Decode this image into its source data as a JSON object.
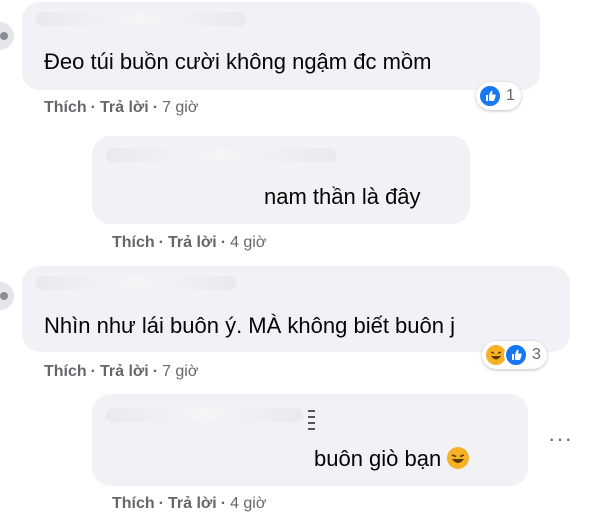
{
  "comments": [
    {
      "text": "Đeo túi buồn cười không ngậm đc mồm",
      "actions": {
        "like": "Thích",
        "reply": "Trả lời",
        "time": "7 giờ"
      },
      "reaction": {
        "icon": "like-icon",
        "count": "1"
      }
    },
    {
      "text": "nam thần là đây",
      "actions": {
        "like": "Thích",
        "reply": "Trả lời",
        "time": "4 giờ"
      }
    },
    {
      "text": "Nhìn như lái buôn ý. MÀ không biết buôn j",
      "actions": {
        "like": "Thích",
        "reply": "Trả lời",
        "time": "7 giờ"
      },
      "reaction": {
        "icons": [
          "haha-icon",
          "like-icon"
        ],
        "count": "3"
      }
    },
    {
      "text": "buôn giò bạn",
      "emoji": "😆",
      "actions": {
        "like": "Thích",
        "reply": "Trả lời",
        "time": "4 giờ"
      },
      "more_icon": "more-options-icon"
    }
  ],
  "separator": "·",
  "more_glyph": "···",
  "colors": {
    "bubble": "#f0f2f5",
    "meta_text": "#65676b",
    "like_blue": "#1877f2",
    "haha_yellow": "#f7b125"
  }
}
